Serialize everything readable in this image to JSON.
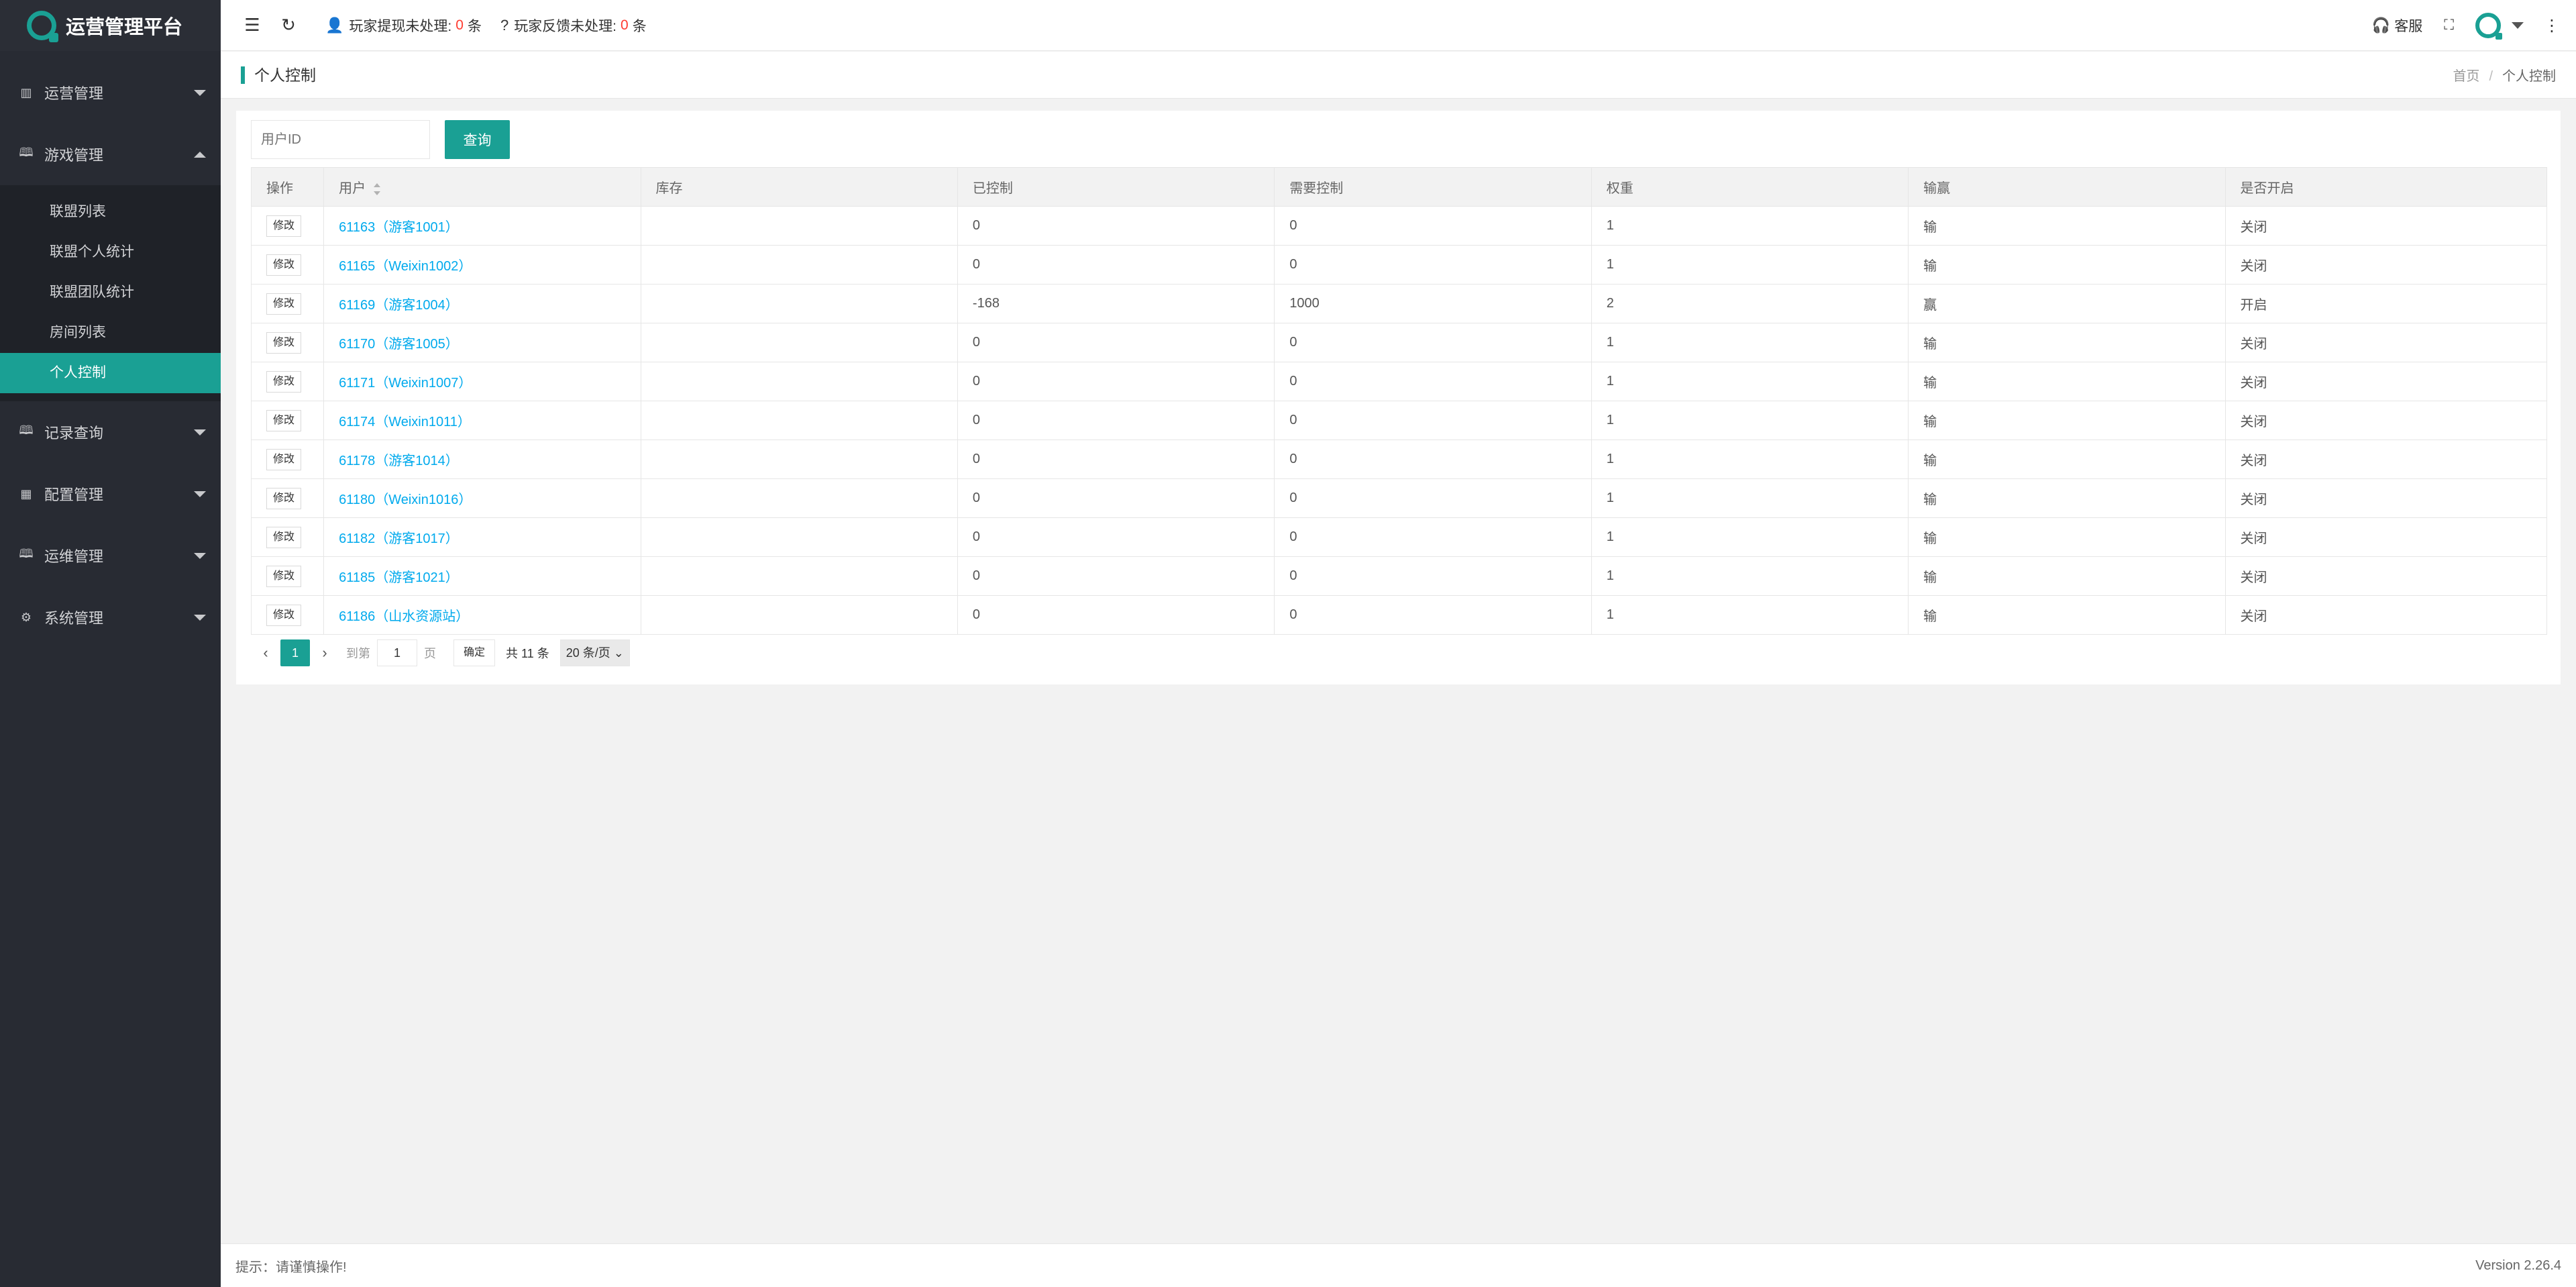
{
  "app": {
    "title": "运营管理平台"
  },
  "sidebar": {
    "menus": [
      {
        "label": "运营管理",
        "icon": "chart-icon",
        "open": false
      },
      {
        "label": "游戏管理",
        "icon": "book-icon",
        "open": true,
        "children": [
          "联盟列表",
          "联盟个人统计",
          "联盟团队统计",
          "房间列表",
          "个人控制"
        ],
        "active": "个人控制"
      },
      {
        "label": "记录查询",
        "icon": "book-icon",
        "open": false
      },
      {
        "label": "配置管理",
        "icon": "grid-icon",
        "open": false
      },
      {
        "label": "运维管理",
        "icon": "book-icon",
        "open": false
      },
      {
        "label": "系统管理",
        "icon": "gear-icon",
        "open": false
      }
    ]
  },
  "header": {
    "notice1": {
      "prefix": "玩家提现未处理:",
      "count": "0",
      "suffix": "条"
    },
    "notice2": {
      "prefix": "玩家反馈未处理:",
      "count": "0",
      "suffix": "条"
    },
    "service": "客服"
  },
  "crumb": {
    "title": "个人控制",
    "home": "首页",
    "current": "个人控制"
  },
  "search": {
    "placeholder": "用户ID",
    "button": "查询"
  },
  "table": {
    "headers": [
      "操作",
      "用户",
      "库存",
      "已控制",
      "需要控制",
      "权重",
      "输赢",
      "是否开启"
    ],
    "op_label": "修改",
    "rows": [
      [
        "61163（游客1001）",
        "",
        "0",
        "0",
        "1",
        "输",
        "关闭"
      ],
      [
        "61165（Weixin1002）",
        "",
        "0",
        "0",
        "1",
        "输",
        "关闭"
      ],
      [
        "61169（游客1004）",
        "",
        "-168",
        "1000",
        "2",
        "赢",
        "开启"
      ],
      [
        "61170（游客1005）",
        "",
        "0",
        "0",
        "1",
        "输",
        "关闭"
      ],
      [
        "61171（Weixin1007）",
        "",
        "0",
        "0",
        "1",
        "输",
        "关闭"
      ],
      [
        "61174（Weixin1011）",
        "",
        "0",
        "0",
        "1",
        "输",
        "关闭"
      ],
      [
        "61178（游客1014）",
        "",
        "0",
        "0",
        "1",
        "输",
        "关闭"
      ],
      [
        "61180（Weixin1016）",
        "",
        "0",
        "0",
        "1",
        "输",
        "关闭"
      ],
      [
        "61182（游客1017）",
        "",
        "0",
        "0",
        "1",
        "输",
        "关闭"
      ],
      [
        "61185（游客1021）",
        "",
        "0",
        "0",
        "1",
        "输",
        "关闭"
      ],
      [
        "61186（山水资源站）",
        "",
        "0",
        "0",
        "1",
        "输",
        "关闭"
      ]
    ]
  },
  "pager": {
    "current": "1",
    "goto_prefix": "到第",
    "goto_value": "1",
    "goto_suffix": "页",
    "confirm": "确定",
    "total": "共 11 条",
    "page_size": "20 条/页"
  },
  "footer": {
    "tip": "提示：请谨慎操作!",
    "version": "Version 2.26.4"
  },
  "colors": {
    "accent": "#1aa094",
    "link": "#01aaed",
    "alert": "#ff3b30",
    "sidebar_bg": "#282b33"
  }
}
